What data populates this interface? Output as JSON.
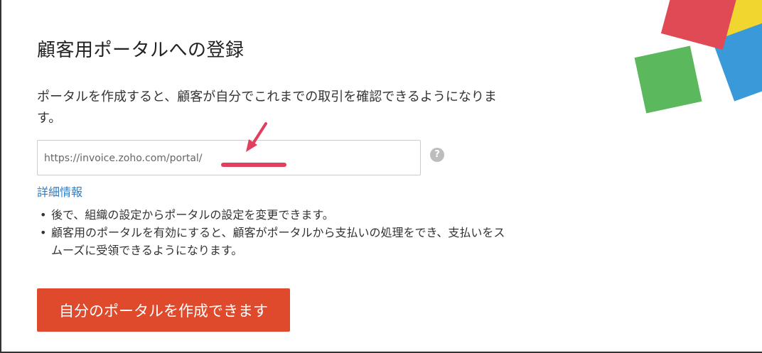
{
  "page": {
    "title": "顧客用ポータルへの登録",
    "description": "ポータルを作成すると、顧客が自分でこれまでの取引を確認できるようになります。"
  },
  "portal_url": {
    "prefix": "https://invoice.zoho.com/portal/",
    "value": "",
    "help_icon": "?"
  },
  "links": {
    "more_info": "詳細情報"
  },
  "notes": [
    "後で、組織の設定からポータルの設定を変更できます。",
    "顧客用のポータルを有効にすると、顧客がポータルから支払いの処理をでき、支払いをスムーズに受領できるようになります。"
  ],
  "actions": {
    "create_button": "自分のポータルを作成できます"
  },
  "colors": {
    "primary_button": "#e04a2c",
    "link": "#2e7ec6",
    "annotation": "#e0405e",
    "decor_red": "#e04a55",
    "decor_orange": "#f08a2c",
    "decor_yellow": "#f2d630",
    "decor_green": "#5cb85c",
    "decor_blue": "#3a9ad9"
  },
  "icons": {
    "help": "question-circle-icon",
    "annotation": "red-arrow-annotation-icon"
  }
}
